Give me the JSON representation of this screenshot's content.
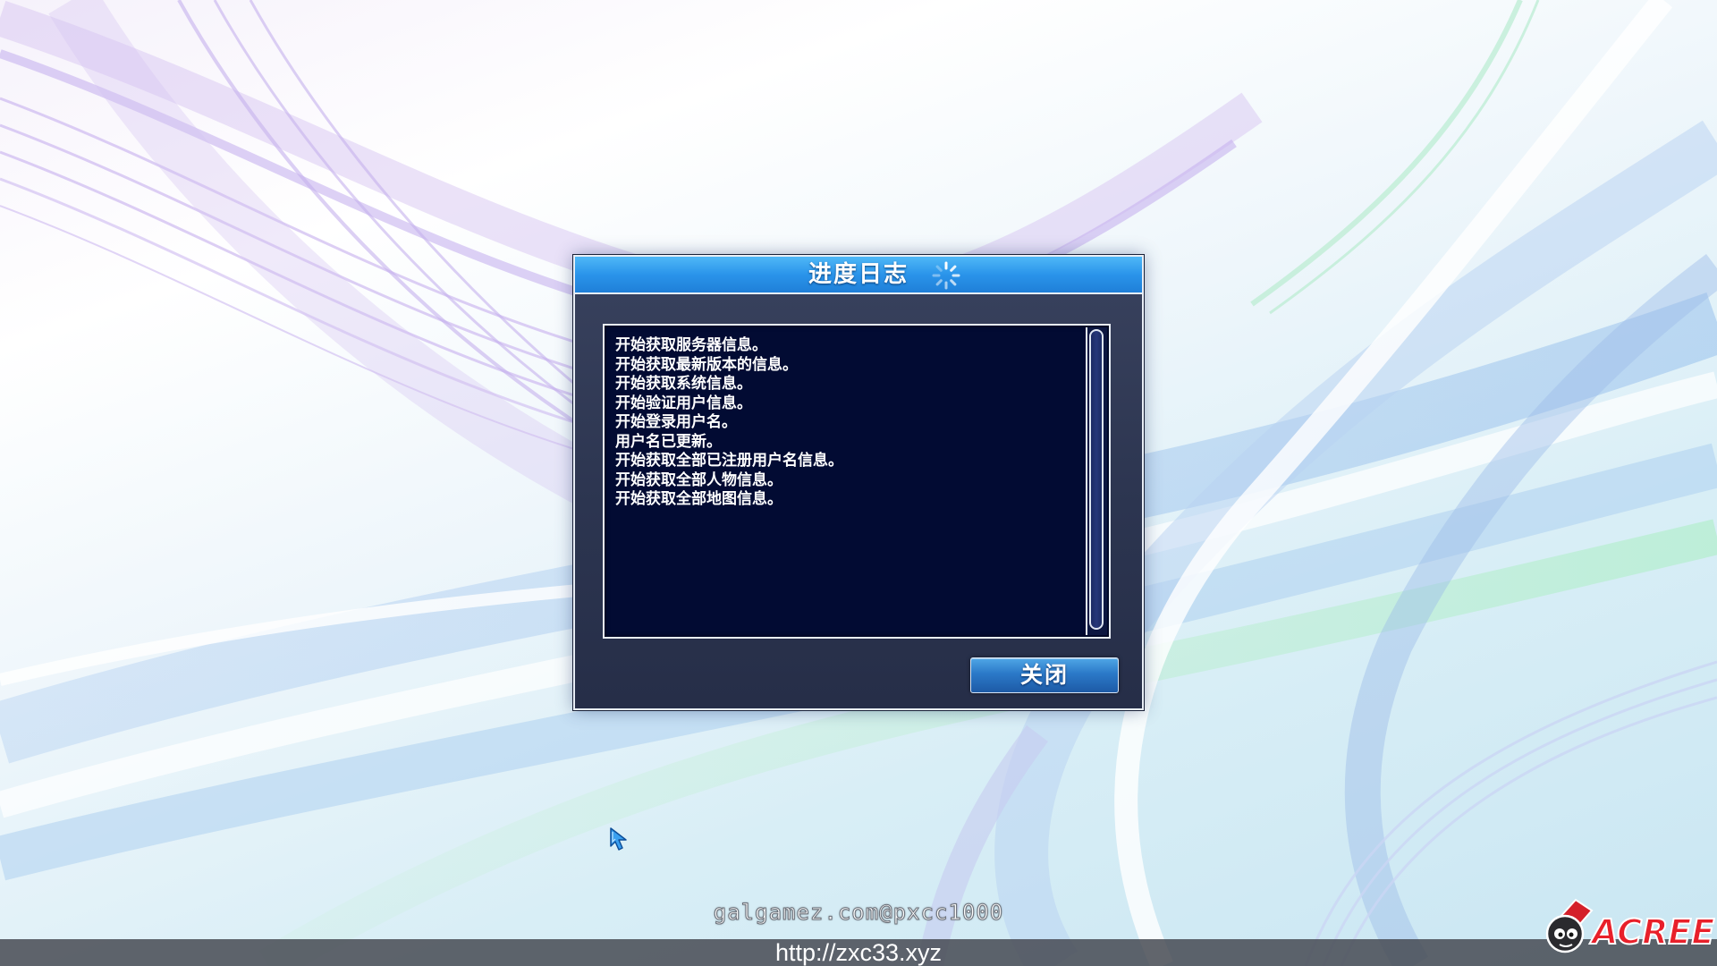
{
  "dialog": {
    "title": "进度日志",
    "close_label": "关闭",
    "spinner_icon": "loading-spinner-icon"
  },
  "log": {
    "lines": [
      "开始获取服务器信息。",
      "开始获取最新版本的信息。",
      "开始获取系统信息。",
      "开始验证用户信息。",
      "开始登录用户名。",
      "用户名已更新。",
      "开始获取全部已注册用户名信息。",
      "开始获取全部人物信息。",
      "开始获取全部地图信息。"
    ]
  },
  "overlay": {
    "watermark": "galgamez.com@pxcc1000",
    "url": "http://zxc33.xyz",
    "logo": "ACREE"
  },
  "colors": {
    "titlebar": "#2a94ea",
    "dialog_bg": "#2c3550",
    "log_bg": "#020b33",
    "button": "#2b79c8",
    "logo_red": "#e8202a"
  }
}
